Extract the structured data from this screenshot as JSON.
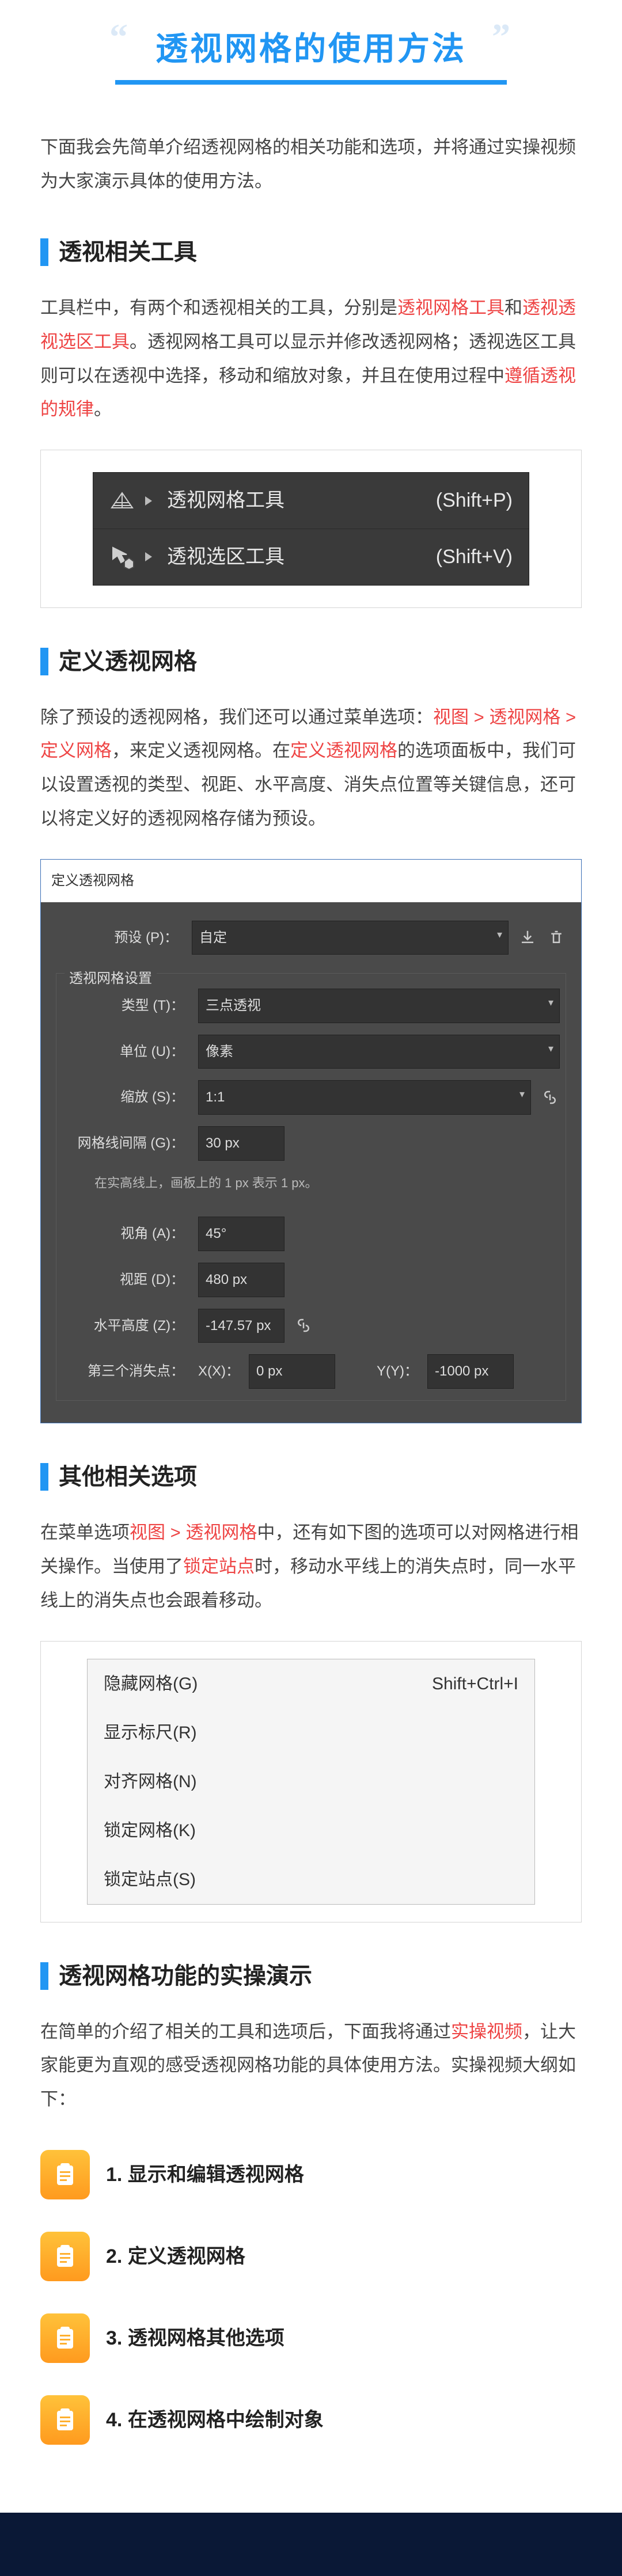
{
  "title": "透视网格的使用方法",
  "intro": "下面我会先简单介绍透视网格的相关功能和选项，并将通过实操视频为大家演示具体的使用方法。",
  "s1": {
    "heading": "透视相关工具",
    "p_a": "工具栏中，有两个和透视相关的工具，分别是",
    "p_b": "透视网格工具",
    "p_c": "和",
    "p_d": "透视透视选区工具",
    "p_e": "。透视网格工具可以显示并修改透视网格；透视选区工具则可以在透视中选择，移动和缩放对象，并且在使用过程中",
    "p_f": "遵循透视的规律",
    "p_g": "。"
  },
  "tools": [
    {
      "name": "透视网格工具",
      "key": "(Shift+P)"
    },
    {
      "name": "透视选区工具",
      "key": "(Shift+V)"
    }
  ],
  "s2": {
    "heading": "定义透视网格",
    "p_a": "除了预设的透视网格，我们还可以通过菜单选项：",
    "p_b": "视图 > 透视网格 > 定义网格",
    "p_c": "，来定义透视网格。在",
    "p_d": "定义透视网格",
    "p_e": "的选项面板中，我们可以设置透视的类型、视距、水平高度、消失点位置等关键信息，还可以将定义好的透视网格存储为预设。"
  },
  "dialog": {
    "title": "定义透视网格",
    "preset_label": "预设 (P)：",
    "preset_value": "自定",
    "section_label": "透视网格设置",
    "type_label": "类型 (T)：",
    "type_value": "三点透视",
    "unit_label": "单位 (U)：",
    "unit_value": "像素",
    "scale_label": "缩放 (S)：",
    "scale_value": "1:1",
    "gap_label": "网格线间隔 (G)：",
    "gap_value": "30 px",
    "hint": "在实高线上，画板上的 1 px 表示 1 px。",
    "angle_label": "视角 (A)：",
    "angle_value": "45°",
    "dist_label": "视距 (D)：",
    "dist_value": "480 px",
    "hh_label": "水平高度 (Z)：",
    "hh_value": "-147.57 px",
    "third_label": "第三个消失点：",
    "third_x_label": "X(X)：",
    "third_x_value": "0 px",
    "third_y_label": "Y(Y)：",
    "third_y_value": "-1000 px"
  },
  "s3": {
    "heading": "其他相关选项",
    "p_a": "在菜单选项",
    "p_b": "视图 > 透视网格",
    "p_c": "中，还有如下图的选项可以对网格进行相关操作。当使用了",
    "p_d": "锁定站点",
    "p_e": "时，移动水平线上的消失点时，同一水平线上的消失点也会跟着移动。"
  },
  "menu": [
    {
      "label": "隐藏网格(G)",
      "key": "Shift+Ctrl+I"
    },
    {
      "label": "显示标尺(R)",
      "key": ""
    },
    {
      "label": "对齐网格(N)",
      "key": ""
    },
    {
      "label": "锁定网格(K)",
      "key": ""
    },
    {
      "label": "锁定站点(S)",
      "key": ""
    }
  ],
  "s4": {
    "heading": "透视网格功能的实操演示",
    "p_a": "在简单的介绍了相关的工具和选项后，下面我将通过",
    "p_b": "实操视频",
    "p_c": "，让大家能更为直观的感受透视网格功能的具体使用方法。实操视频大纲如下："
  },
  "videos": [
    {
      "idx": "1.",
      "label": "显示和编辑透视网格"
    },
    {
      "idx": "2.",
      "label": "定义透视网格"
    },
    {
      "idx": "3.",
      "label": "透视网格其他选项"
    },
    {
      "idx": "4.",
      "label": "在透视网格中绘制对象"
    }
  ]
}
